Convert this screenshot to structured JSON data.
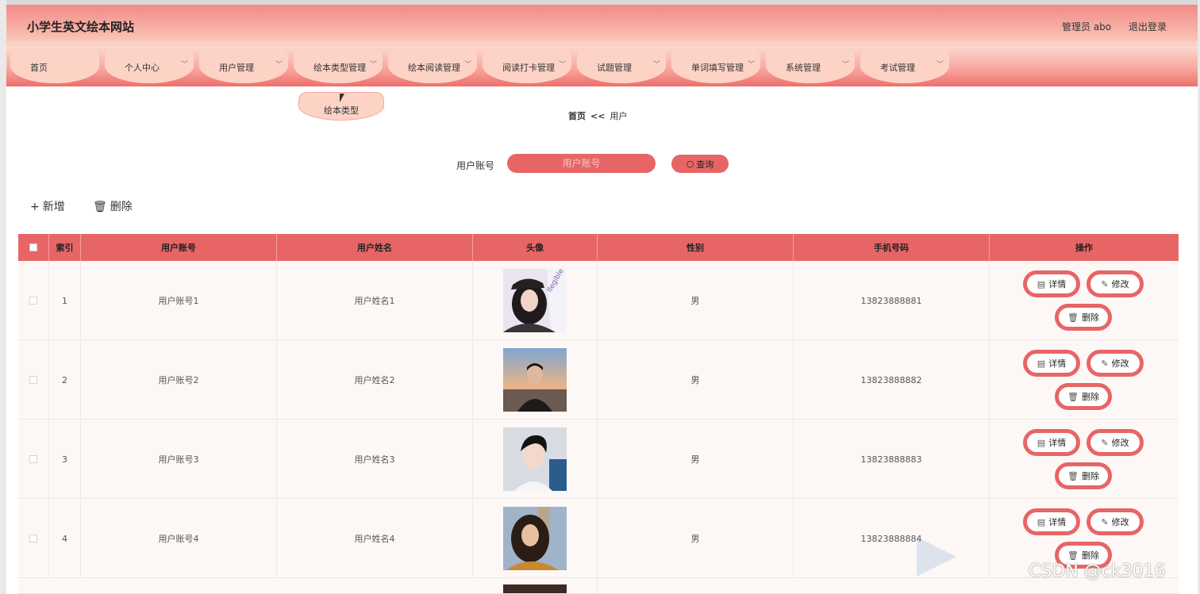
{
  "header": {
    "title": "小学生英文绘本网站",
    "user": "管理员 abo",
    "logout": "退出登录"
  },
  "nav": {
    "items": [
      {
        "label": "首页",
        "has_dropdown": false
      },
      {
        "label": "个人中心",
        "has_dropdown": true
      },
      {
        "label": "用户管理",
        "has_dropdown": true
      },
      {
        "label": "绘本类型管理",
        "has_dropdown": true
      },
      {
        "label": "绘本阅读管理",
        "has_dropdown": true
      },
      {
        "label": "阅读打卡管理",
        "has_dropdown": true
      },
      {
        "label": "试题管理",
        "has_dropdown": true
      },
      {
        "label": "单词填写管理",
        "has_dropdown": true
      },
      {
        "label": "系统管理",
        "has_dropdown": true
      },
      {
        "label": "考试管理",
        "has_dropdown": true
      }
    ],
    "dropdown_open": {
      "item": "绘本类型管理",
      "options": [
        "绘本类型"
      ]
    }
  },
  "breadcrumb": {
    "home": "首页",
    "separator": "<<",
    "current": "用户"
  },
  "search": {
    "label": "用户账号",
    "placeholder": "用户账号",
    "button": "查询"
  },
  "actions": {
    "add": "新增",
    "delete": "删除"
  },
  "table": {
    "columns": [
      "索引",
      "用户账号",
      "用户姓名",
      "头像",
      "性别",
      "手机号码",
      "操作"
    ],
    "rows": [
      {
        "index": "1",
        "account": "用户账号1",
        "name": "用户姓名1",
        "gender": "男",
        "phone": "13823888881"
      },
      {
        "index": "2",
        "account": "用户账号2",
        "name": "用户姓名2",
        "gender": "男",
        "phone": "13823888882"
      },
      {
        "index": "3",
        "account": "用户账号3",
        "name": "用户姓名3",
        "gender": "男",
        "phone": "13823888883"
      },
      {
        "index": "4",
        "account": "用户账号4",
        "name": "用户姓名4",
        "gender": "男",
        "phone": "13823888884"
      }
    ],
    "row_buttons": {
      "detail": "详情",
      "edit": "修改",
      "delete": "删除"
    }
  },
  "watermark": "CSDN @ck3016",
  "colors": {
    "accent": "#e86566",
    "nav_tab": "#fdd3c6",
    "row_bg": "#fdf8f6"
  }
}
